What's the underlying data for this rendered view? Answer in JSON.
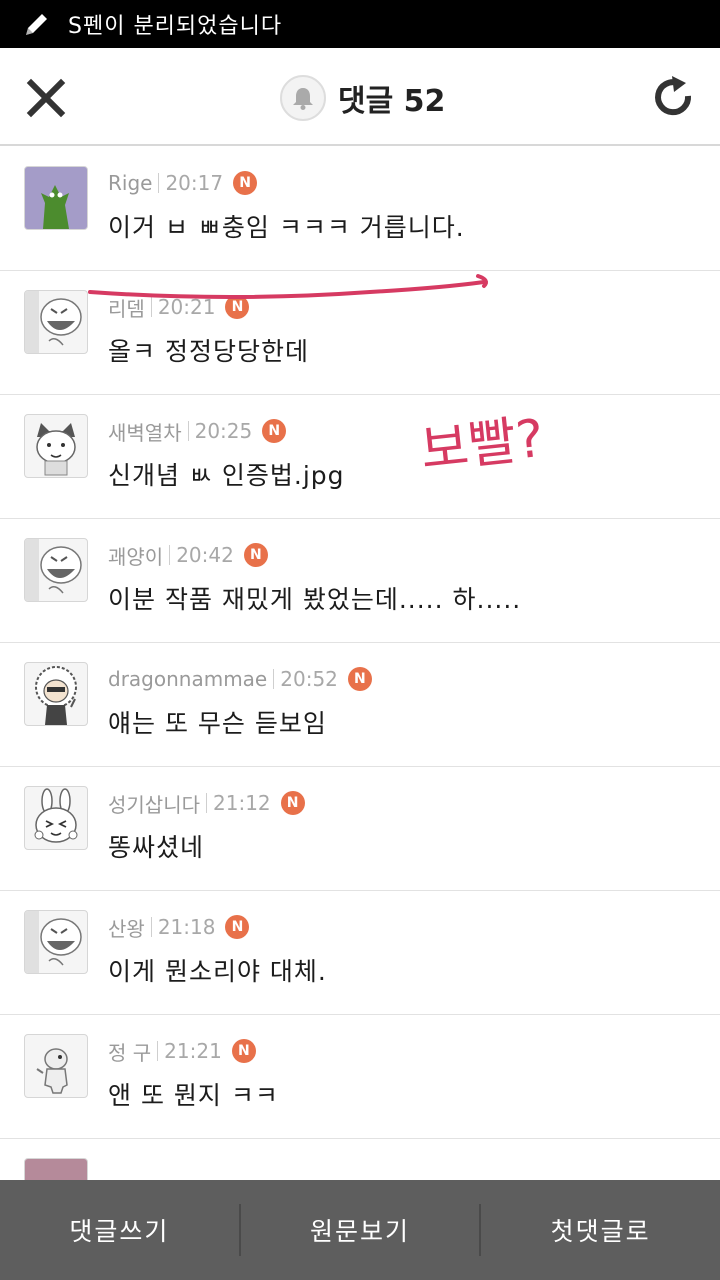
{
  "status_bar": {
    "text": "S펜이 분리되었습니다",
    "icon": "pen-icon"
  },
  "header": {
    "title": "댓글 52",
    "close_icon": "close-icon",
    "bell_icon": "bell-icon",
    "refresh_icon": "refresh-icon"
  },
  "comments": [
    {
      "user": "Rige",
      "time": "20:17",
      "badge": "N",
      "text": "이거 ㅂ ㅃ충임 ㅋㅋㅋ 거릅니다.",
      "avatar": "green-creature-avatar"
    },
    {
      "user": "리뎀",
      "time": "20:21",
      "badge": "N",
      "text": "올ㅋ 정정당당한데",
      "avatar": "laughing-face-avatar"
    },
    {
      "user": "새벽열차",
      "time": "20:25",
      "badge": "N",
      "text": "신개념 ㅄ 인증법.jpg",
      "avatar": "cat-character-avatar"
    },
    {
      "user": "괘양이",
      "time": "20:42",
      "badge": "N",
      "text": "이분 작품 재밌게 봤었는데..... 하.....",
      "avatar": "laughing-face-avatar"
    },
    {
      "user": "dragonnammae",
      "time": "20:52",
      "badge": "N",
      "text": "얘는 또 무슨 듣보임",
      "avatar": "afro-character-avatar"
    },
    {
      "user": "성기삽니다",
      "time": "21:12",
      "badge": "N",
      "text": "똥싸셨네",
      "avatar": "rabbit-avatar"
    },
    {
      "user": "산왕",
      "time": "21:18",
      "badge": "N",
      "text": "이게 뭔소리야 대체.",
      "avatar": "laughing-face-avatar"
    },
    {
      "user": "정 구",
      "time": "21:21",
      "badge": "N",
      "text": "앤 또 뭔지 ㅋㅋ",
      "avatar": "small-figure-avatar"
    }
  ],
  "annotation": {
    "text": "보빨?",
    "color": "#d63a62"
  },
  "bottom_bar": {
    "write": "댓글쓰기",
    "original": "원문보기",
    "first": "첫댓글로"
  },
  "colors": {
    "badge": "#e8714a",
    "bottom_bar": "#5e5e5e",
    "status_bar": "#000000"
  }
}
